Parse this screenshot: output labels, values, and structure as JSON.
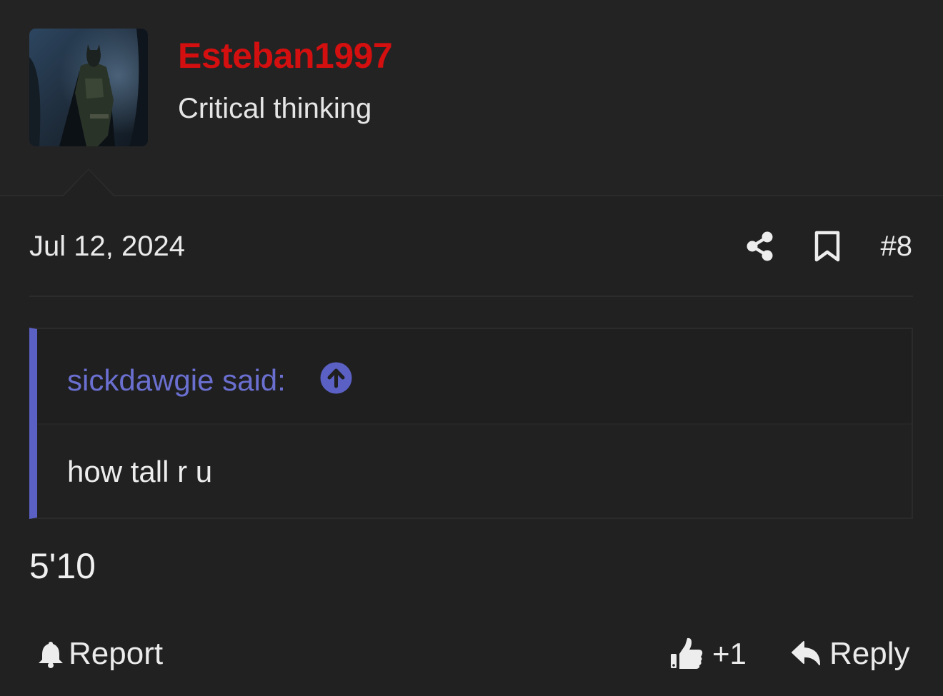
{
  "user": {
    "name": "Esteban1997",
    "title": "Critical thinking",
    "name_color": "#d40f0f"
  },
  "post": {
    "date": "Jul 12, 2024",
    "number": "#8",
    "body": "5'10"
  },
  "quote": {
    "author_line": "sickdawgie said:",
    "text": "how tall r u",
    "accent_color": "#5b60c4"
  },
  "actions": {
    "report": "Report",
    "like_count": "+1",
    "reply": "Reply"
  },
  "icons": [
    "share-icon",
    "bookmark-icon",
    "arrow-up-circle-icon",
    "bell-icon",
    "thumbs-up-icon",
    "reply-arrow-icon"
  ]
}
